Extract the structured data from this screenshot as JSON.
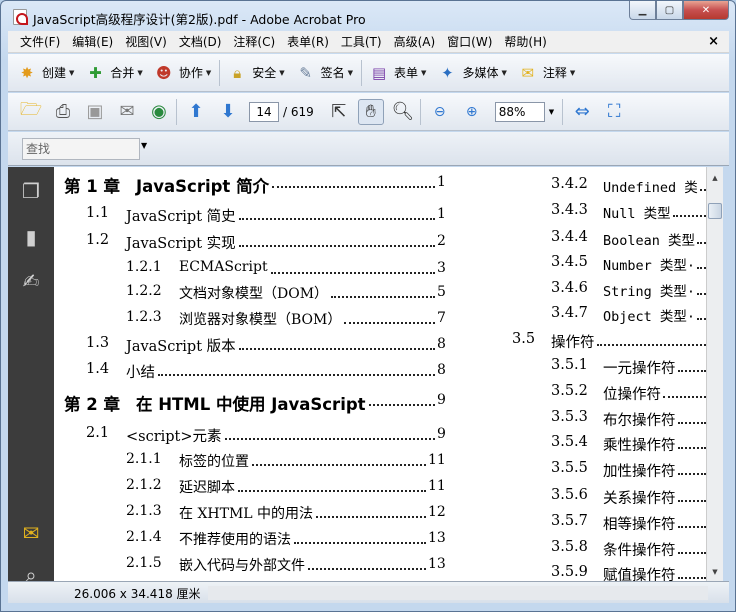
{
  "window": {
    "title": "JavaScript高级程序设计(第2版).pdf - Adobe Acrobat Pro"
  },
  "menu": [
    "文件(F)",
    "编辑(E)",
    "视图(V)",
    "文档(D)",
    "注释(C)",
    "表单(R)",
    "工具(T)",
    "高级(A)",
    "窗口(W)",
    "帮助(H)"
  ],
  "menu_close": "×",
  "tasks": [
    {
      "label": "创建",
      "icon": "create-icon"
    },
    {
      "label": "合并",
      "icon": "combine-icon"
    },
    {
      "label": "协作",
      "icon": "collaborate-icon"
    },
    {
      "label": "安全",
      "icon": "lock-icon"
    },
    {
      "label": "签名",
      "icon": "pen-icon"
    },
    {
      "label": "表单",
      "icon": "form-icon"
    },
    {
      "label": "多媒体",
      "icon": "multimedia-icon"
    },
    {
      "label": "注释",
      "icon": "comment-icon"
    }
  ],
  "nav": {
    "page_current": "14",
    "page_total": "/ 619",
    "zoom": "88%"
  },
  "find": {
    "placeholder": "查找"
  },
  "status": {
    "page_size": "26.006 x 34.418 厘米"
  },
  "toc_left": [
    {
      "num": "第 1 章",
      "title": "JavaScript 简介",
      "page": "1",
      "level": 1
    },
    {
      "num": "1.1",
      "title": "JavaScript 简史",
      "page": "1",
      "level": 2
    },
    {
      "num": "1.2",
      "title": "JavaScript 实现",
      "page": "2",
      "level": 2
    },
    {
      "num": "1.2.1",
      "title": "ECMAScript",
      "page": "3",
      "level": 3
    },
    {
      "num": "1.2.2",
      "title": "文档对象模型（DOM）",
      "page": "5",
      "level": 3
    },
    {
      "num": "1.2.3",
      "title": "浏览器对象模型（BOM）",
      "page": "7",
      "level": 3
    },
    {
      "num": "1.3",
      "title": "JavaScript 版本",
      "page": "8",
      "level": 2
    },
    {
      "num": "1.4",
      "title": "小结",
      "page": "8",
      "level": 2
    },
    {
      "num": "第 2 章",
      "title": "在 HTML 中使用 JavaScript",
      "page": "9",
      "level": 1
    },
    {
      "num": "2.1",
      "title": "<script>元素",
      "page": "9",
      "level": 2
    },
    {
      "num": "2.1.1",
      "title": "标签的位置",
      "page": "11",
      "level": 3
    },
    {
      "num": "2.1.2",
      "title": "延迟脚本",
      "page": "11",
      "level": 3
    },
    {
      "num": "2.1.3",
      "title": "在 XHTML 中的用法",
      "page": "12",
      "level": 3
    },
    {
      "num": "2.1.4",
      "title": "不推荐使用的语法",
      "page": "13",
      "level": 3
    },
    {
      "num": "2.1.5",
      "title": "嵌入代码与外部文件",
      "page": "13",
      "level": 3
    }
  ],
  "toc_right": [
    {
      "num": "3.4.2",
      "title": "Undefined 类"
    },
    {
      "num": "3.4.3",
      "title": "Null 类型"
    },
    {
      "num": "3.4.4",
      "title": "Boolean 类型"
    },
    {
      "num": "3.4.5",
      "title": "Number 类型·"
    },
    {
      "num": "3.4.6",
      "title": "String 类型·"
    },
    {
      "num": "3.4.7",
      "title": "Object 类型·"
    },
    {
      "num": "3.5",
      "title": "操作符"
    },
    {
      "num": "3.5.1",
      "title": "一元操作符"
    },
    {
      "num": "3.5.2",
      "title": "位操作符"
    },
    {
      "num": "3.5.3",
      "title": "布尔操作符"
    },
    {
      "num": "3.5.4",
      "title": "乘性操作符"
    },
    {
      "num": "3.5.5",
      "title": "加性操作符"
    },
    {
      "num": "3.5.6",
      "title": "关系操作符"
    },
    {
      "num": "3.5.7",
      "title": "相等操作符"
    },
    {
      "num": "3.5.8",
      "title": "条件操作符"
    },
    {
      "num": "3.5.9",
      "title": "赋值操作符"
    }
  ]
}
